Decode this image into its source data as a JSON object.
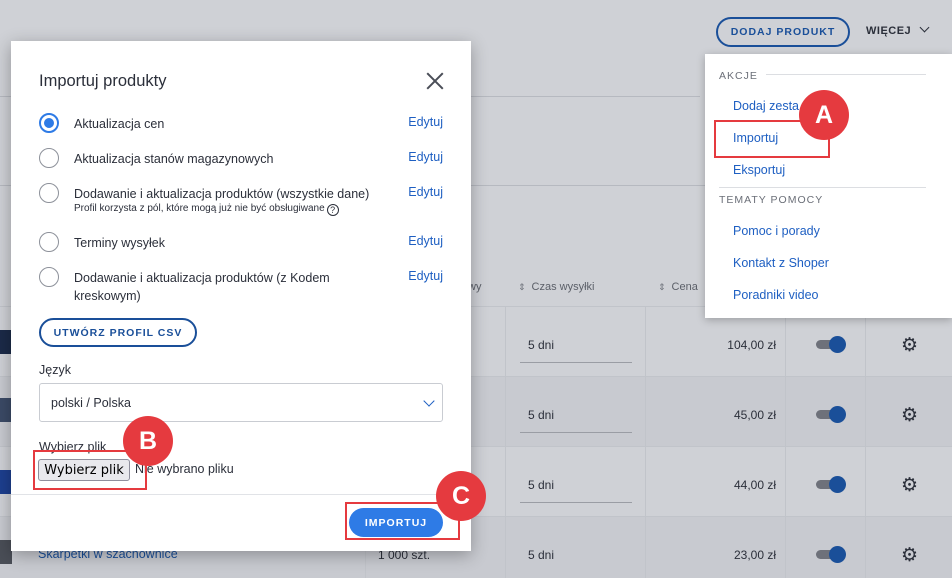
{
  "header": {
    "add_product": "DODAJ PRODUKT",
    "more": "WIĘCEJ"
  },
  "dropdown": {
    "section_actions": "AKCJE",
    "actions": [
      "Dodaj zesta",
      "Importuj",
      "Eksportuj"
    ],
    "section_help": "TEMATY POMOCY",
    "help": [
      "Pomoc i porady",
      "Kontakt z Shoper",
      "Poradniki video"
    ]
  },
  "table": {
    "col_partial": "wy",
    "col_shipping": "Czas wysyłki",
    "col_price": "Cena",
    "rows": [
      {
        "shipping": "5 dni",
        "price": "104,00 zł"
      },
      {
        "shipping": "5 dni",
        "price": "45,00 zł"
      },
      {
        "shipping": "5 dni",
        "price": "44,00 zł"
      },
      {
        "shipping": "5 dni",
        "price": "23,00 zł",
        "name": "Skarpetki w szachownice",
        "qty": "1 000 szt."
      }
    ]
  },
  "modal": {
    "title": "Importuj produkty",
    "options": [
      {
        "label": "Aktualizacja cen",
        "edit": "Edytuj",
        "checked": true
      },
      {
        "label": "Aktualizacja stanów magazynowych",
        "edit": "Edytuj"
      },
      {
        "label": "Dodawanie i aktualizacja produktów (wszystkie dane)",
        "sub": "Profil korzysta z pól, które mogą już nie być obsługiwane",
        "edit": "Edytuj"
      },
      {
        "label": "Terminy wysyłek",
        "edit": "Edytuj"
      },
      {
        "label": "Dodawanie i aktualizacja produktów (z Kodem kreskowym)",
        "edit": "Edytuj"
      }
    ],
    "csv_button": "UTWÓRZ PROFIL CSV",
    "language_label": "Język",
    "language_value": "polski / Polska",
    "file_label": "Wybierz plik",
    "file_button": "Wybierz plik",
    "file_status": "Nie wybrano pliku",
    "import_button": "IMPORTUJ"
  },
  "annotations": {
    "a": "A",
    "b": "B",
    "c": "C"
  },
  "colors": {
    "accent": "#2e7be6",
    "brand_dark": "#1a4f99",
    "highlight": "#e53a3f"
  }
}
